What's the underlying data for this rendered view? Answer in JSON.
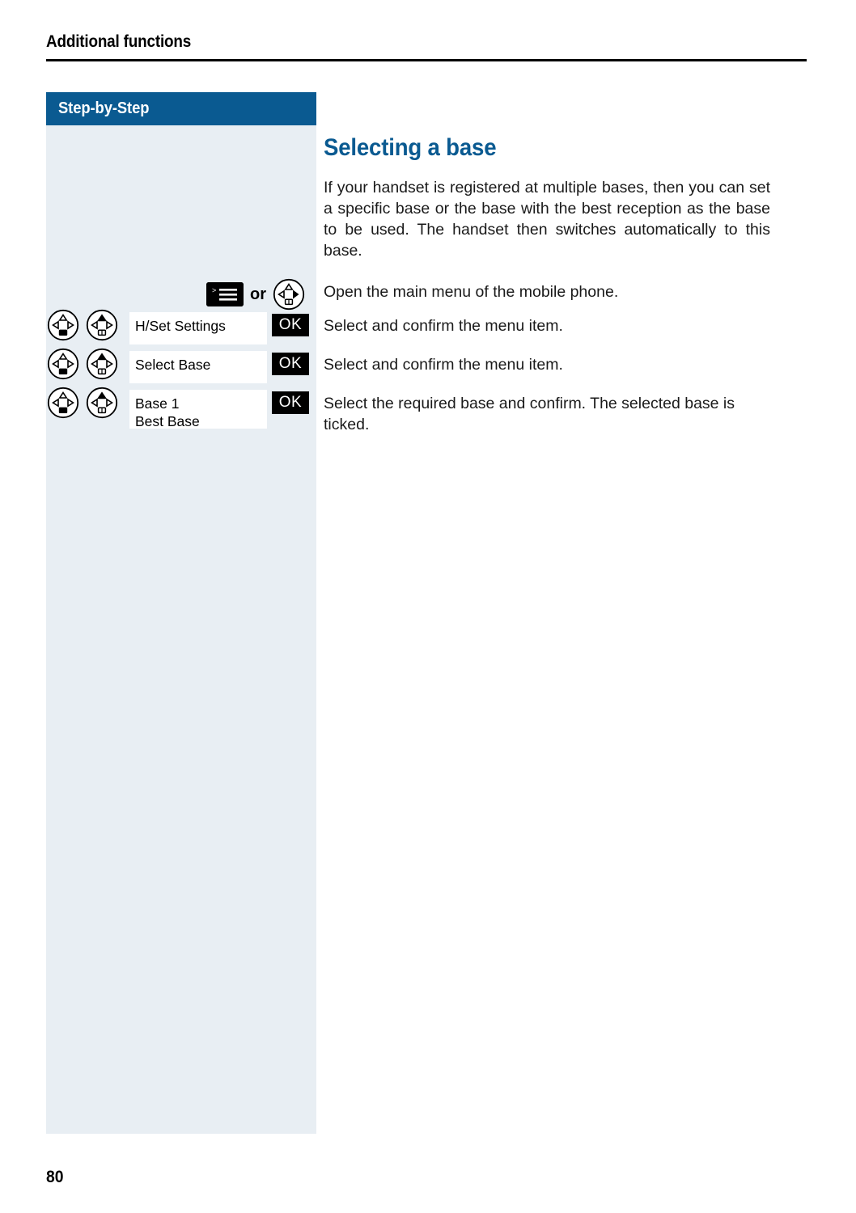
{
  "header": {
    "running_head": "Additional functions"
  },
  "sidebar": {
    "title": "Step-by-Step",
    "background_color": "#e8eef3",
    "header_color": "#0a5a91"
  },
  "content": {
    "title": "Selecting a base",
    "title_color": "#0a5a91",
    "intro": "If your handset is registered at multiple bases, then you can set a specific base or the base with the best recep-tion as the base to be used. The handset then switches automatically to this base."
  },
  "steps": [
    {
      "icons": [
        "menu-key-icon",
        "or-label",
        "nav-key-right-icon"
      ],
      "or_label": "or",
      "display_lines": [],
      "ok_label": "",
      "description": "Open the main menu of the mobile phone."
    },
    {
      "icons": [
        "nav-key-down-icon",
        "nav-key-up-icon"
      ],
      "display_lines": [
        "H/Set Settings"
      ],
      "ok_label": "OK",
      "description": "Select and confirm the menu item."
    },
    {
      "icons": [
        "nav-key-down-icon",
        "nav-key-up-icon"
      ],
      "display_lines": [
        "Select Base"
      ],
      "ok_label": "OK",
      "description": "Select and confirm the menu item."
    },
    {
      "icons": [
        "nav-key-down-icon",
        "nav-key-up-icon"
      ],
      "display_lines": [
        "Base 1",
        "Best Base"
      ],
      "ok_label": "OK",
      "description": "Select the required base and confirm. The selected base is ticked."
    }
  ],
  "footer": {
    "page_number": "80"
  }
}
